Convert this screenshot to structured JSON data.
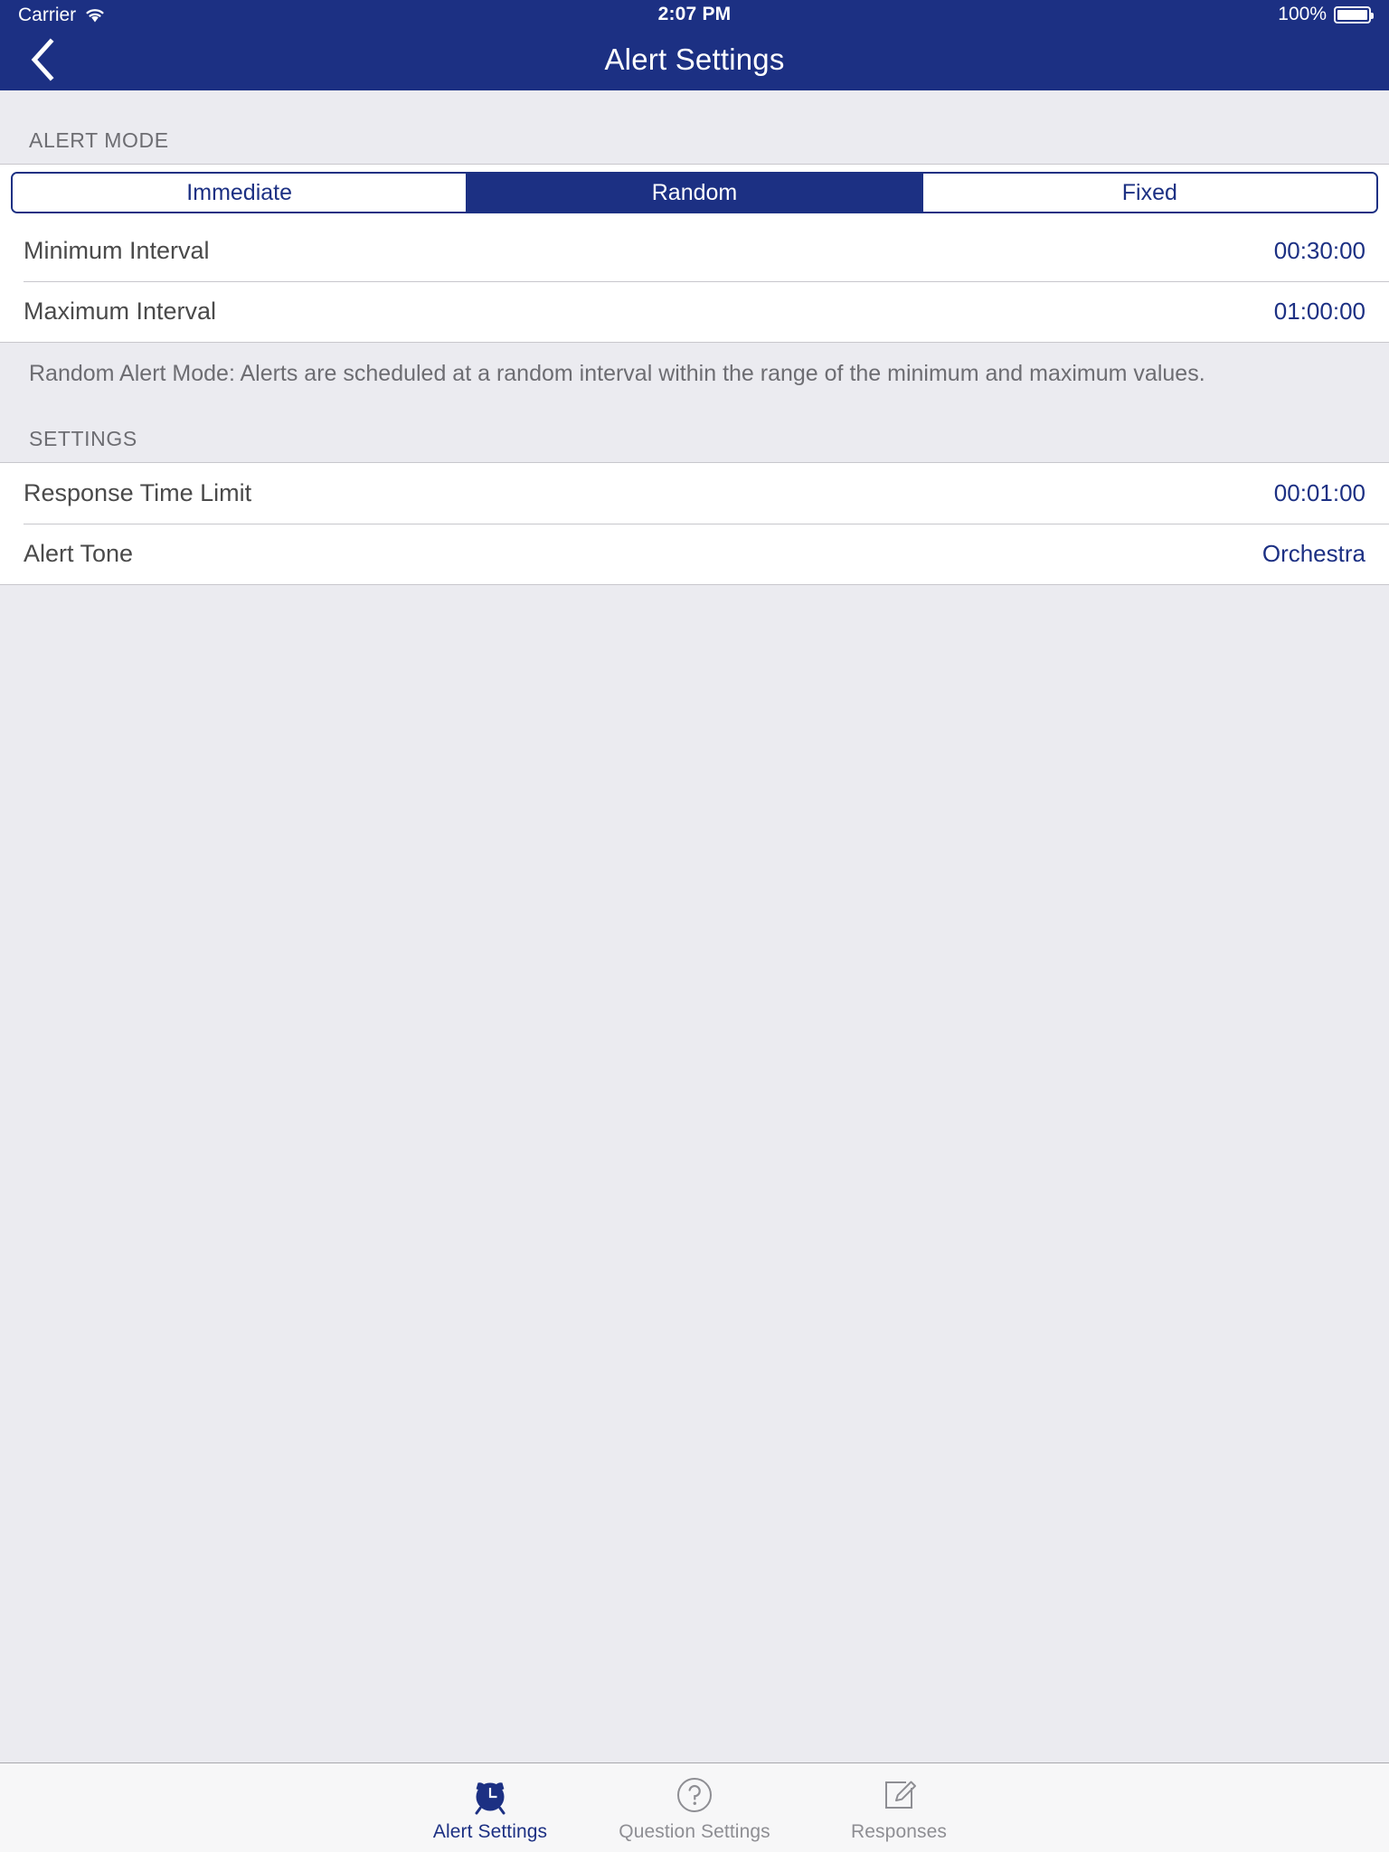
{
  "status_bar": {
    "carrier": "Carrier",
    "wifi_icon": "wifi-icon",
    "time": "2:07 PM",
    "battery_percent": "100%",
    "battery_icon": "battery-icon"
  },
  "nav": {
    "back_icon": "chevron-left-icon",
    "title": "Alert Settings"
  },
  "alert_mode": {
    "header": "ALERT MODE",
    "segments": [
      {
        "label": "Immediate",
        "selected": false
      },
      {
        "label": "Random",
        "selected": true
      },
      {
        "label": "Fixed",
        "selected": false
      }
    ],
    "rows": [
      {
        "label": "Minimum Interval",
        "value": "00:30:00"
      },
      {
        "label": "Maximum Interval",
        "value": "01:00:00"
      }
    ],
    "footer": "Random Alert Mode: Alerts are scheduled at a random interval within the range of the minimum and maximum values."
  },
  "settings": {
    "header": "SETTINGS",
    "rows": [
      {
        "label": "Response Time Limit",
        "value": "00:01:00"
      },
      {
        "label": "Alert Tone",
        "value": "Orchestra"
      }
    ]
  },
  "tab_bar": {
    "tabs": [
      {
        "label": "Alert Settings",
        "icon": "alarm-clock-icon",
        "active": true
      },
      {
        "label": "Question Settings",
        "icon": "question-circle-icon",
        "active": false
      },
      {
        "label": "Responses",
        "icon": "pencil-square-icon",
        "active": false
      }
    ]
  },
  "colors": {
    "brand_navy": "#1c3083",
    "group_background": "#ebebf0",
    "row_background": "#ffffff",
    "separator": "#c8c7cc",
    "secondary_text": "#6d6d72",
    "inactive_tab": "#8e8e93"
  }
}
